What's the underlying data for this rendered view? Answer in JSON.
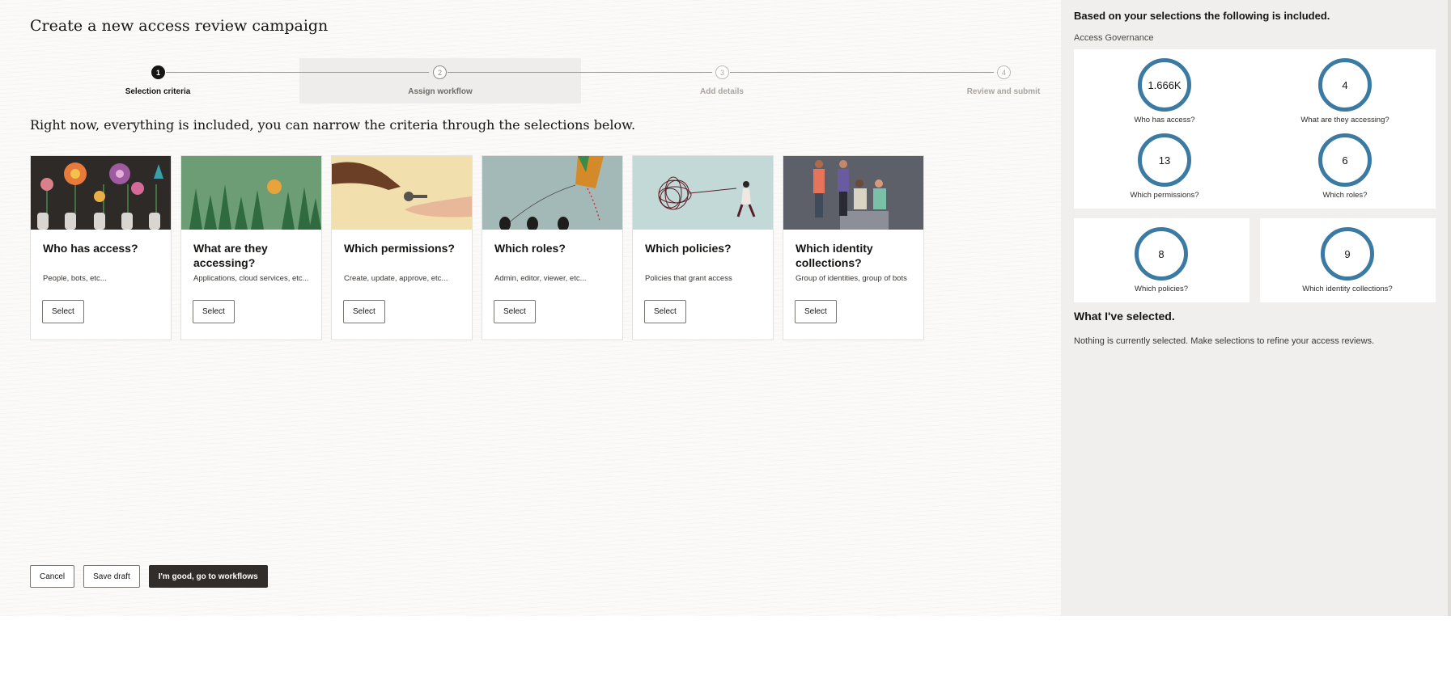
{
  "page": {
    "title": "Create a new access review campaign"
  },
  "stepper": {
    "steps": [
      {
        "number": "1",
        "label": "Selection criteria",
        "state": "active"
      },
      {
        "number": "2",
        "label": "Assign workflow",
        "state": "upcoming"
      },
      {
        "number": "3",
        "label": "Add details",
        "state": "upcoming"
      },
      {
        "number": "4",
        "label": "Review and submit",
        "state": "upcoming"
      }
    ]
  },
  "instruction": "Right now, everything is included, you can narrow the criteria through the selections below.",
  "cards": [
    {
      "title": "Who has access?",
      "description": "People, bots, etc...",
      "button": "Select",
      "image": "flowers-and-hands-illustration"
    },
    {
      "title": "What are they accessing?",
      "description": "Applications, cloud services, etc...",
      "button": "Select",
      "image": "forest-and-sun-illustration"
    },
    {
      "title": "Which permissions?",
      "description": "Create, update, approve, etc...",
      "button": "Select",
      "image": "key-handover-illustration"
    },
    {
      "title": "Which roles?",
      "description": "Admin, editor, viewer, etc...",
      "button": "Select",
      "image": "kite-illustration"
    },
    {
      "title": "Which policies?",
      "description": "Policies that grant access",
      "button": "Select",
      "image": "tangled-line-illustration"
    },
    {
      "title": "Which identity collections?",
      "description": "Group of identities, group of bots",
      "button": "Select",
      "image": "group-meeting-illustration"
    }
  ],
  "footer": {
    "cancel": "Cancel",
    "save_draft": "Save draft",
    "primary": "I'm good, go to workflows"
  },
  "panel": {
    "heading": "Based on your selections the following is included.",
    "subheading": "Access Governance",
    "stats": [
      {
        "value": "1.666K",
        "label": "Who has access?"
      },
      {
        "value": "4",
        "label": "What are they accessing?"
      },
      {
        "value": "13",
        "label": "Which permissions?"
      },
      {
        "value": "6",
        "label": "Which roles?"
      },
      {
        "value": "8",
        "label": "Which policies?"
      },
      {
        "value": "9",
        "label": "Which identity collections?"
      }
    ],
    "selected_title": "What I've selected.",
    "selected_text": "Nothing is currently selected. Make selections to refine your access reviews."
  },
  "colors": {
    "ring": "#3b7aa3",
    "primary_button": "#312d2a",
    "panel_bg": "#f1efed"
  }
}
